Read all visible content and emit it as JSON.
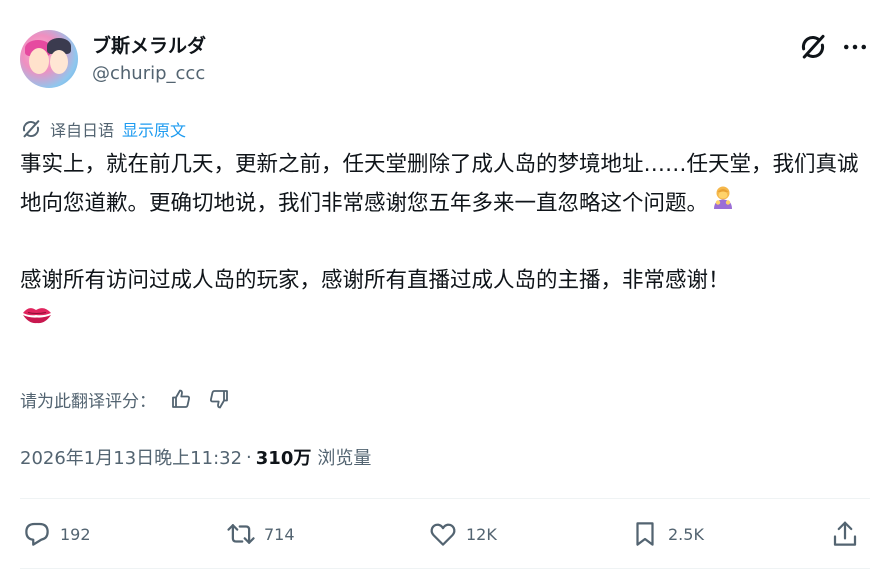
{
  "author": {
    "display_name": "ブ斯メラルダ",
    "handle": "@churip_ccc"
  },
  "translation": {
    "label": "译自日语",
    "show_original": "显示原文"
  },
  "post": {
    "paragraph1": "事实上，就在前几天，更新之前，任天堂删除了成人岛的梦境地址……任天堂，我们真诚地向您道歉。更确切地说，我们非常感谢您五年多来一直忽略这个问题。",
    "paragraph2": "感谢所有访问过成人岛的玩家，感谢所有直播过成人岛的主播，非常感谢！"
  },
  "rating": {
    "prompt": "请为此翻译评分："
  },
  "meta": {
    "timestamp": "2026年1月13日晚上11:32",
    "separator": "·",
    "views": "310万",
    "views_label": "浏览量"
  },
  "actions": {
    "replies": "192",
    "reposts": "714",
    "likes": "12K",
    "bookmarks": "2.5K"
  },
  "colors": {
    "link": "#1d9bf0",
    "secondary_text": "#536471",
    "primary_text": "#0f1419"
  }
}
